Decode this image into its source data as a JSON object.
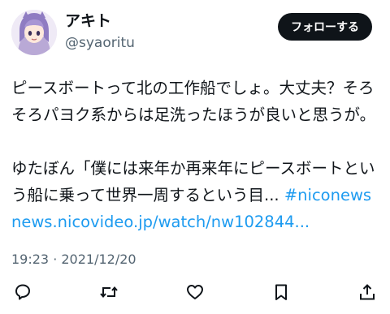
{
  "user": {
    "display_name": "アキト",
    "handle": "@syaoritu",
    "follow_label": "フォローする"
  },
  "tweet": {
    "line1": "ピースボートって北の工作船でしょ。大丈夫？そろそろパヨク系からは足洗ったほうが良いと思うが。",
    "quote_text": "ゆたぼん「僕には来年か再来年にピースボートという船に乗って世界一周するという目... ",
    "hashtag": "#niconews",
    "url": "news.nicovideo.jp/watch/nw102844..."
  },
  "meta": {
    "timestamp": "19:23 · 2021/12/20"
  },
  "actions": [
    {
      "name": "reply",
      "icon": "reply-icon"
    },
    {
      "name": "retweet",
      "icon": "retweet-icon"
    },
    {
      "name": "like",
      "icon": "heart-icon"
    },
    {
      "name": "bookmark",
      "icon": "bookmark-icon"
    },
    {
      "name": "share",
      "icon": "share-icon"
    }
  ],
  "colors": {
    "link": "#1d9bf0",
    "secondary_text": "#536471",
    "button_bg": "#0f1419"
  }
}
